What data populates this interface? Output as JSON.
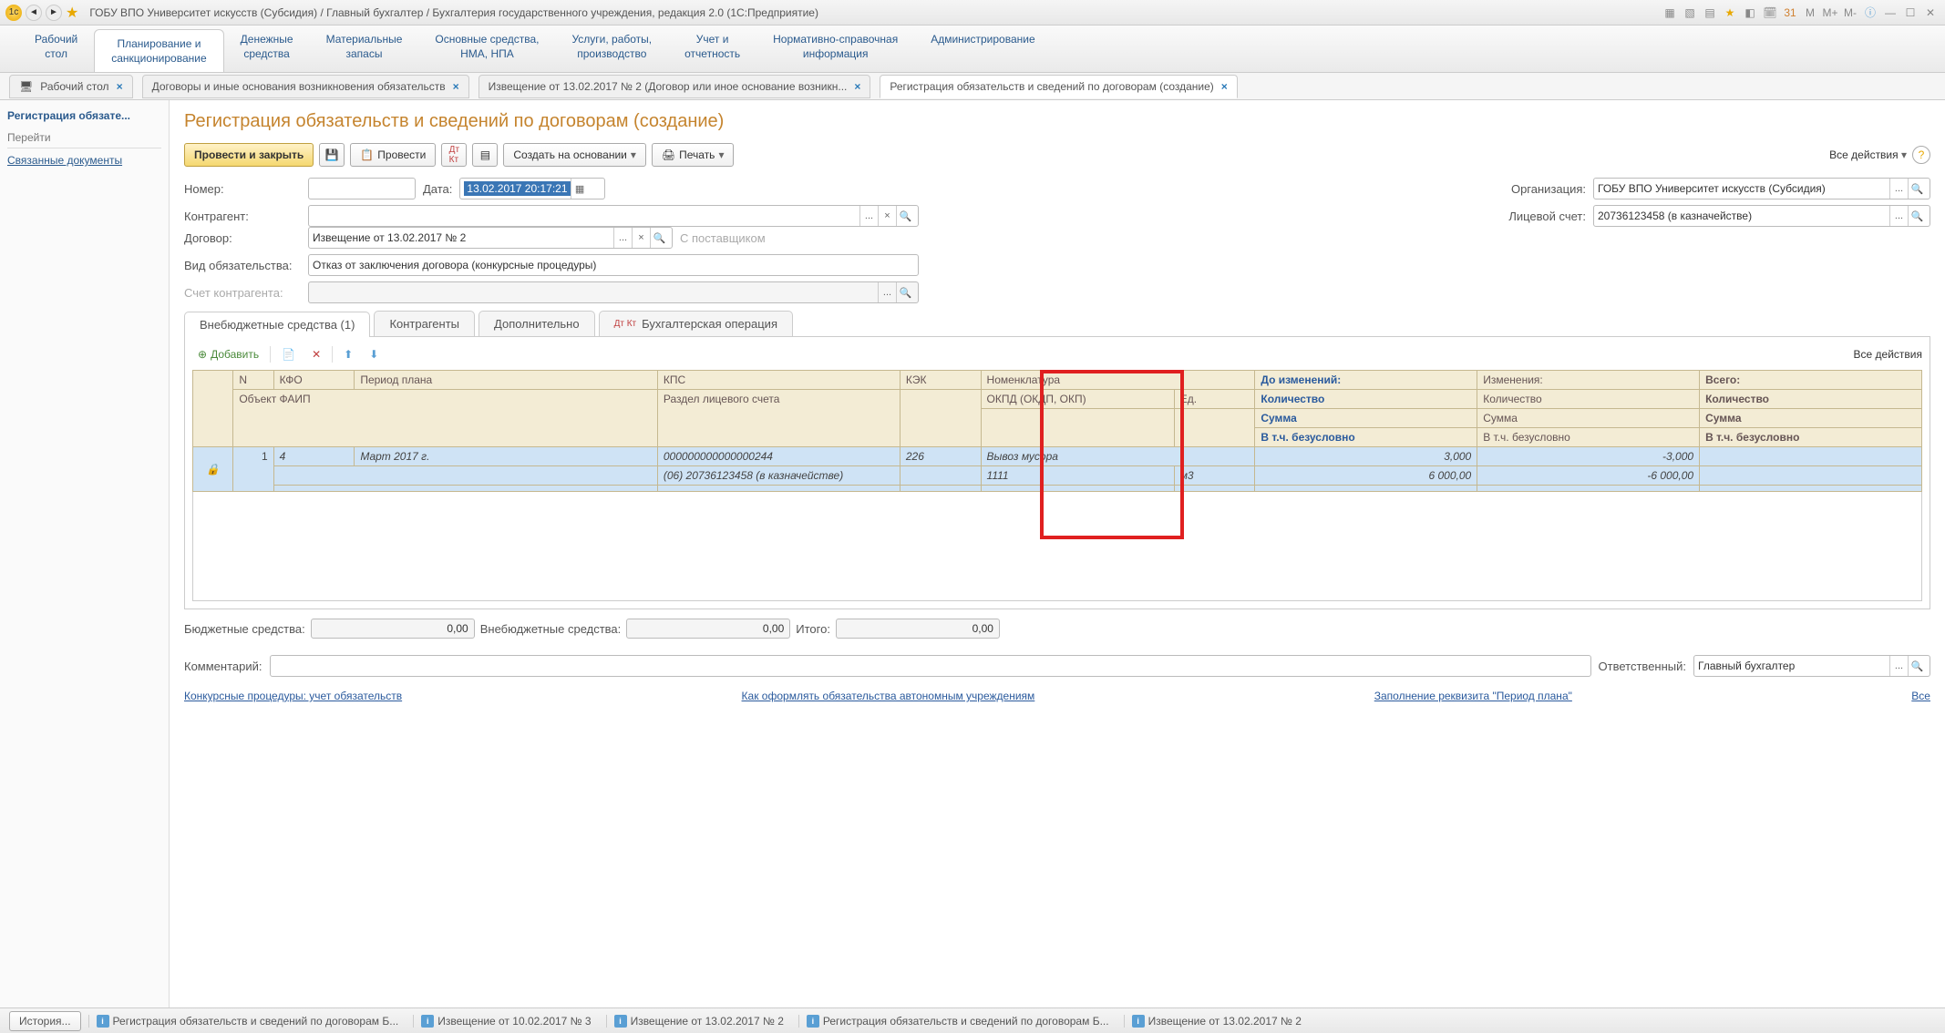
{
  "titlebar": {
    "text": "ГОБУ ВПО Университет искусств (Субсидия) / Главный бухгалтер / Бухгалтерия государственного учреждения, редакция 2.0  (1С:Предприятие)"
  },
  "sections": [
    {
      "l1": "Рабочий",
      "l2": "стол"
    },
    {
      "l1": "Планирование и",
      "l2": "санкционирование",
      "active": true
    },
    {
      "l1": "Денежные",
      "l2": "средства"
    },
    {
      "l1": "Материальные",
      "l2": "запасы"
    },
    {
      "l1": "Основные средства,",
      "l2": "НМА, НПА"
    },
    {
      "l1": "Услуги, работы,",
      "l2": "производство"
    },
    {
      "l1": "Учет и",
      "l2": "отчетность"
    },
    {
      "l1": "Нормативно-справочная",
      "l2": "информация"
    },
    {
      "l1": "Администрирование",
      "l2": ""
    }
  ],
  "doctabs": [
    {
      "label": "Рабочий стол"
    },
    {
      "label": "Договоры и иные основания возникновения обязательств"
    },
    {
      "label": "Извещение от 13.02.2017 № 2 (Договор или иное основание возникн..."
    },
    {
      "label": "Регистрация обязательств и сведений по договорам (создание)",
      "active": true
    }
  ],
  "left": {
    "title": "Регистрация обязате...",
    "section": "Перейти",
    "link": "Связанные документы"
  },
  "page": {
    "title": "Регистрация обязательств и сведений по договорам (создание)"
  },
  "toolbar": {
    "post_close": "Провести и закрыть",
    "post": "Провести",
    "create_based": "Создать на основании",
    "print": "Печать",
    "all_actions": "Все действия"
  },
  "form": {
    "number_label": "Номер:",
    "number_value": "",
    "date_label": "Дата:",
    "date_value": "13.02.2017 20:17:21",
    "org_label": "Организация:",
    "org_value": "ГОБУ ВПО Университет искусств (Субсидия)",
    "contragent_label": "Контрагент:",
    "contragent_value": "",
    "account_label": "Лицевой счет:",
    "account_value": "20736123458 (в казначействе)",
    "contract_label": "Договор:",
    "contract_value": "Извещение от 13.02.2017 № 2",
    "contract_hint": "С поставщиком",
    "obligation_type_label": "Вид обязательства:",
    "obligation_type_value": "Отказ от заключения договора (конкурсные процедуры)",
    "contragent_account_label": "Счет контрагента:",
    "contragent_account_value": ""
  },
  "innertabs": [
    {
      "label": "Внебюджетные средства (1)",
      "active": true
    },
    {
      "label": "Контрагенты"
    },
    {
      "label": "Дополнительно"
    },
    {
      "label": "Бухгалтерская операция",
      "icon": true
    }
  ],
  "panel_toolbar": {
    "add": "Добавить",
    "all_actions": "Все действия"
  },
  "table": {
    "headers": {
      "n": "N",
      "kfo": "КФО",
      "period": "Период плана",
      "object": "Объект ФАИП",
      "kps": "КПС",
      "section": "Раздел лицевого счета",
      "kek": "КЭК",
      "nomen": "Номенклатура",
      "okpd": "ОКПД (ОКДП,  ОКП)",
      "ed": "Ед.",
      "before": "До изменений:",
      "changes": "Изменения:",
      "total": "Всего:",
      "qty": "Количество",
      "sum": "Сумма",
      "uncond": "В т.ч. безусловно"
    },
    "row": {
      "n": "1",
      "kfo": "4",
      "period": "Март 2017 г.",
      "kps": "000000000000000244",
      "section": "(06) 20736123458 (в казначействе)",
      "kek": "226",
      "nomen": "Вывоз мусора",
      "okpd": "1111",
      "ed": "м3",
      "before_qty": "3,000",
      "before_sum": "6 000,00",
      "change_qty": "-3,000",
      "change_sum": "-6 000,00"
    }
  },
  "totals": {
    "budget_label": "Бюджетные средства:",
    "budget_value": "0,00",
    "nonbudget_label": "Внебюджетные средства:",
    "nonbudget_value": "0,00",
    "total_label": "Итого:",
    "total_value": "0,00"
  },
  "comment": {
    "label": "Комментарий:",
    "value": "",
    "resp_label": "Ответственный:",
    "resp_value": "Главный бухгалтер"
  },
  "links": {
    "l1": "Конкурсные процедуры: учет обязательств",
    "l2": "Как оформлять обязательства автономным учреждениям",
    "l3": "Заполнение реквизита \"Период плана\"",
    "all": "Все"
  },
  "statusbar": {
    "history": "История...",
    "items": [
      "Регистрация обязательств и сведений по договорам Б...",
      "Извещение от 10.02.2017 № 3",
      "Извещение от 13.02.2017 № 2",
      "Регистрация обязательств и сведений по договорам Б...",
      "Извещение от 13.02.2017 № 2"
    ]
  }
}
